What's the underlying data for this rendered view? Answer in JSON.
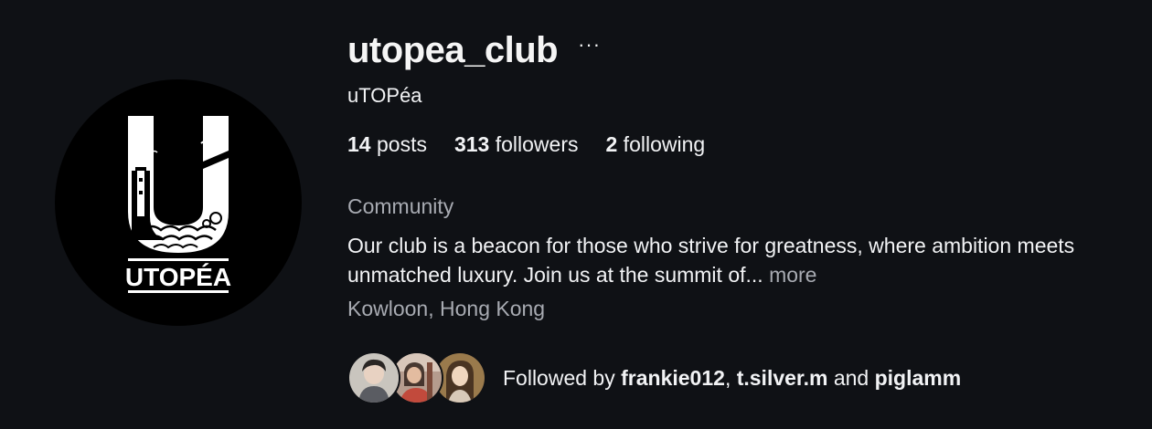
{
  "profile": {
    "username": "utopea_club",
    "more_icon": "ellipsis-icon",
    "more_glyph": "···",
    "display_name": "uTOPéa",
    "avatar_logo_text": "UTOPÉA",
    "avatar_logo_letter": "U"
  },
  "stats": {
    "posts_count": "14",
    "posts_label": " posts",
    "followers_count": "313",
    "followers_label": " followers",
    "following_count": "2",
    "following_label": " following"
  },
  "bio": {
    "category": "Community",
    "text": "Our club is a beacon for those who strive for greatness, where ambition meets unmatched luxury. Join us at the summit of... ",
    "more_label": "more",
    "location": "Kowloon, Hong Kong"
  },
  "followed_by": {
    "prefix": "Followed by ",
    "user1": "frankie012",
    "sep1": ", ",
    "user2": "t.silver.m",
    "sep2": " and ",
    "user3": "piglamm"
  },
  "colors": {
    "background": "#0f1115",
    "text": "#f2f3f5",
    "muted": "#a8abb2"
  }
}
